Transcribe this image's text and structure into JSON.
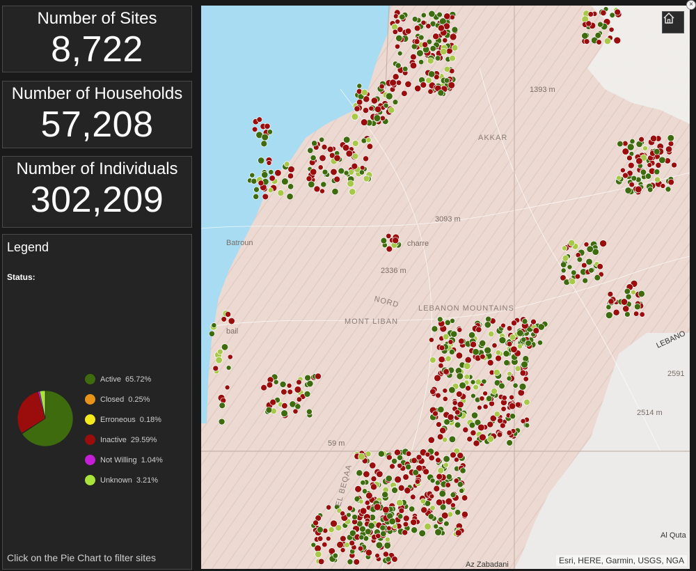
{
  "cards": {
    "sites": {
      "title": "Number of Sites",
      "value": "8,722"
    },
    "households": {
      "title": "Number of Households",
      "value": "57,208"
    },
    "individuals": {
      "title": "Number of Individuals",
      "value": "302,209"
    }
  },
  "legend": {
    "title": "Legend",
    "status_label": "Status:",
    "hint": "Click on the Pie Chart to filter sites",
    "items": [
      {
        "label": "Active",
        "pct": "65.72%",
        "value": 65.72,
        "color": "#3e6b0e"
      },
      {
        "label": "Closed",
        "pct": "0.25%",
        "value": 0.25,
        "color": "#e8941a"
      },
      {
        "label": "Erroneous",
        "pct": "0.18%",
        "value": 0.18,
        "color": "#f2ea1c"
      },
      {
        "label": "Inactive",
        "pct": "29.59%",
        "value": 29.59,
        "color": "#9b0d0d"
      },
      {
        "label": "Not Willing",
        "pct": "1.04%",
        "value": 1.04,
        "color": "#c41fd6"
      },
      {
        "label": "Unknown",
        "pct": "3.21%",
        "value": 3.21,
        "color": "#a8e43a"
      }
    ]
  },
  "map": {
    "labels": {
      "akkar": "AKKAR",
      "mont_liban": "MONT LIBAN",
      "nord": "NORD",
      "lebanon_mountains": "LEBANON MOUNTAINS",
      "lebanon": "LEBANO",
      "batroun": "Batroun",
      "bcharre": "charre",
      "jbail": "bail",
      "el_beqaa": "EL BEQAA",
      "az_zabadani": "Az Zabadani",
      "al_quta": "Al Quta",
      "el1": "1393 m",
      "el2": "3093 m",
      "el3": "2336 m",
      "el4": "2591",
      "el5": "2514 m",
      "el6": "59 m"
    },
    "attribution": "Esri, HERE, Garmin, USGS, NGA",
    "home_icon": "home-icon"
  }
}
